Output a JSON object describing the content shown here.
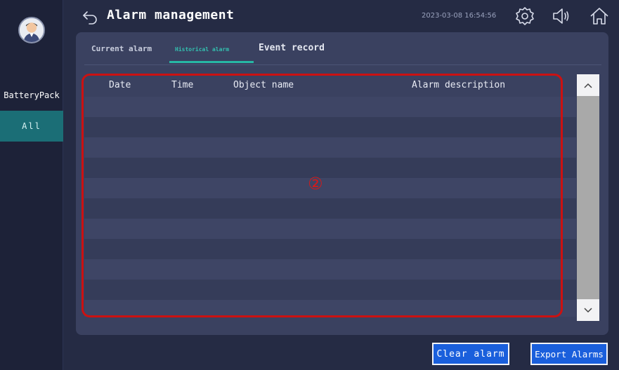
{
  "sidebar": {
    "items": [
      {
        "label": "BatteryPack"
      },
      {
        "label": "All"
      }
    ]
  },
  "header": {
    "title": "Alarm management",
    "datetime": "2023-03-08 16:54:56",
    "icons": [
      "back-arrow-icon",
      "gear-icon",
      "speaker-icon",
      "home-icon"
    ]
  },
  "tabs": [
    {
      "label": "Current alarm"
    },
    {
      "label": "Historical alarm",
      "active": true
    },
    {
      "label": "Event record"
    }
  ],
  "table": {
    "columns": [
      "Date",
      "Time",
      "Object name",
      "Alarm description"
    ],
    "rows": []
  },
  "annotation": {
    "marker": "②",
    "color": "#cc1111"
  },
  "buttons": {
    "clear": "Clear alarm",
    "export": "Export Alarms"
  },
  "colors": {
    "accent": "#27b7a4",
    "button": "#1a5fdc",
    "sidebar_active": "#1b6e76"
  }
}
